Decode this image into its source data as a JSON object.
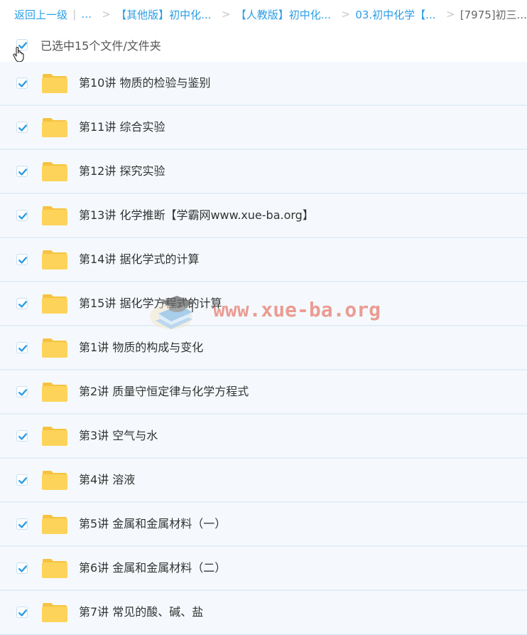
{
  "breadcrumb": {
    "back": "返回上一级",
    "sep_pipe": "|",
    "ellipsis": "...",
    "sep1": ">",
    "crumb1": "【其他版】初中化...",
    "sep2": ">",
    "crumb2": "【人教版】初中化...",
    "sep3": ">",
    "crumb3": "03.初中化学【...",
    "sep4": ">",
    "current": "[7975]初三..."
  },
  "selection": {
    "count_text": "已选中15个文件/文件夹",
    "checked": true
  },
  "folders": [
    {
      "name": "第10讲 物质的检验与鉴别",
      "checked": true
    },
    {
      "name": "第11讲 综合实验",
      "checked": true
    },
    {
      "name": "第12讲 探究实验",
      "checked": true
    },
    {
      "name": "第13讲 化学推断【学霸网www.xue-ba.org】",
      "checked": true
    },
    {
      "name": "第14讲 据化学式的计算",
      "checked": true
    },
    {
      "name": "第15讲 据化学方程式的计算",
      "checked": true
    },
    {
      "name": "第1讲 物质的构成与变化",
      "checked": true
    },
    {
      "name": "第2讲 质量守恒定律与化学方程式",
      "checked": true
    },
    {
      "name": "第3讲 空气与水",
      "checked": true
    },
    {
      "name": "第4讲 溶液",
      "checked": true
    },
    {
      "name": "第5讲 金属和金属材料（一）",
      "checked": true
    },
    {
      "name": "第6讲 金属和金属材料（二）",
      "checked": true
    },
    {
      "name": "第7讲 常见的酸、碱、盐",
      "checked": true
    }
  ],
  "watermark": {
    "text": "www.xue-ba.org"
  },
  "colors": {
    "link": "#2b9ee6",
    "check": "#2b9ee6",
    "row_bg": "#f5f9fd",
    "folder": "#fdd35a",
    "watermark": "#e2503c"
  },
  "icons": {
    "checkbox": "checkbox-checked-icon",
    "folder": "folder-icon",
    "cursor": "hand-pointer-icon",
    "watermark_logo": "graduation-cap-books-icon"
  }
}
